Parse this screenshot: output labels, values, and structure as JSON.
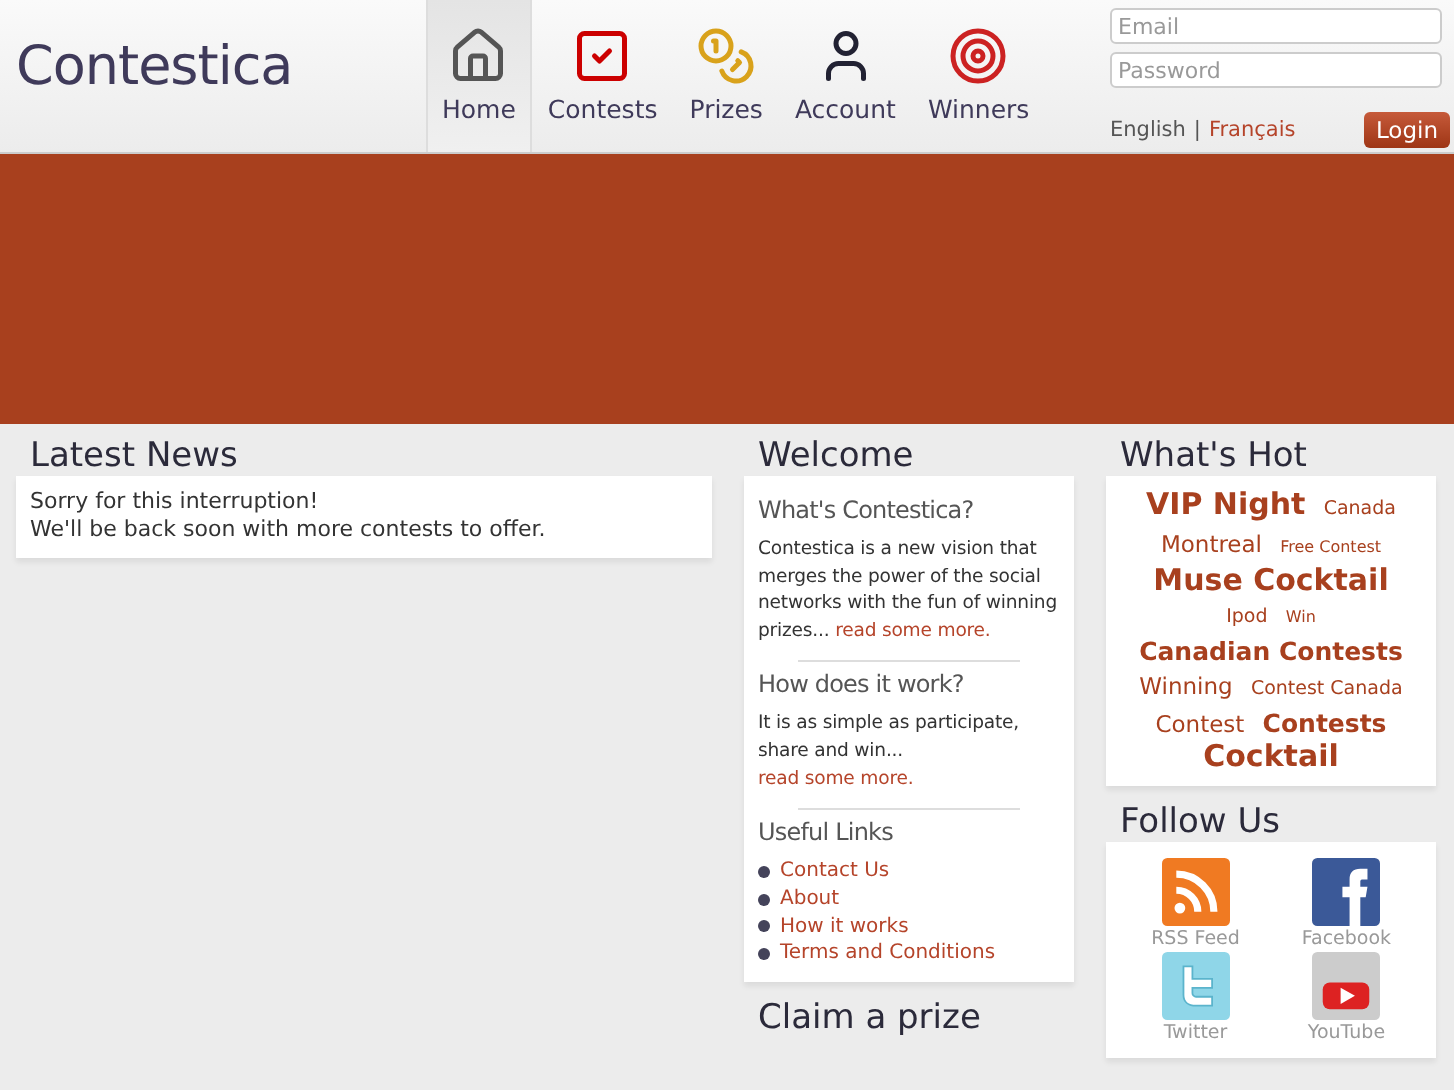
{
  "logo": "Contestica",
  "nav": [
    {
      "label": "Home",
      "kind": "house",
      "selected": true
    },
    {
      "label": "Contests",
      "kind": "check",
      "selected": false
    },
    {
      "label": "Prizes",
      "kind": "coins",
      "selected": false
    },
    {
      "label": "Account",
      "kind": "person",
      "selected": false
    },
    {
      "label": "Winners",
      "kind": "target",
      "selected": false
    }
  ],
  "login": {
    "email_placeholder": "Email",
    "password_placeholder": "Password",
    "languages": [
      {
        "label": "English",
        "selected": true
      },
      {
        "label": "Français",
        "selected": false
      }
    ],
    "separator": "|",
    "button": "Login"
  },
  "latest_news": {
    "title": "Latest News",
    "lines": [
      "Sorry for this interruption!",
      "We'll be back soon with more contests to offer."
    ]
  },
  "welcome": {
    "title": "Welcome",
    "sections": [
      {
        "heading": "What's Contestica?",
        "text": "Contestica is a new vision that merges the power of the social networks with the fun of winning prizes...",
        "link": "read some more."
      },
      {
        "heading": "How does it work?",
        "text": "It is as simple as participate, share and win...",
        "link": "read some more."
      }
    ],
    "links_heading": "Useful Links",
    "links": [
      "Contact Us",
      "About",
      "How it works",
      "Terms and Conditions"
    ]
  },
  "claim": {
    "title": "Claim a prize"
  },
  "whats_hot": {
    "title": "What's Hot",
    "tags": [
      {
        "label": "VIP Night",
        "kind": "xl"
      },
      {
        "label": "Canada",
        "kind": "sm"
      },
      {
        "label": "Montreal",
        "kind": "md"
      },
      {
        "label": "Free Contest",
        "kind": "xs"
      },
      {
        "label": "Muse Cocktail",
        "kind": "xl"
      },
      {
        "label": "Ipod",
        "kind": "sm"
      },
      {
        "label": "Win",
        "kind": "xs"
      },
      {
        "label": "Canadian Contests",
        "kind": "lg"
      },
      {
        "label": "Winning",
        "kind": "md"
      },
      {
        "label": "Contest Canada",
        "kind": "sm"
      },
      {
        "label": "Contest",
        "kind": "md"
      },
      {
        "label": "Contests",
        "kind": "lg"
      },
      {
        "label": "Cocktail",
        "kind": "xl"
      }
    ]
  },
  "follow_us": {
    "title": "Follow Us",
    "items": [
      {
        "label": "RSS Feed",
        "kind": "rss"
      },
      {
        "label": "Facebook",
        "kind": "facebook"
      },
      {
        "label": "Twitter",
        "kind": "twitter"
      },
      {
        "label": "YouTube",
        "kind": "youtube"
      }
    ]
  }
}
